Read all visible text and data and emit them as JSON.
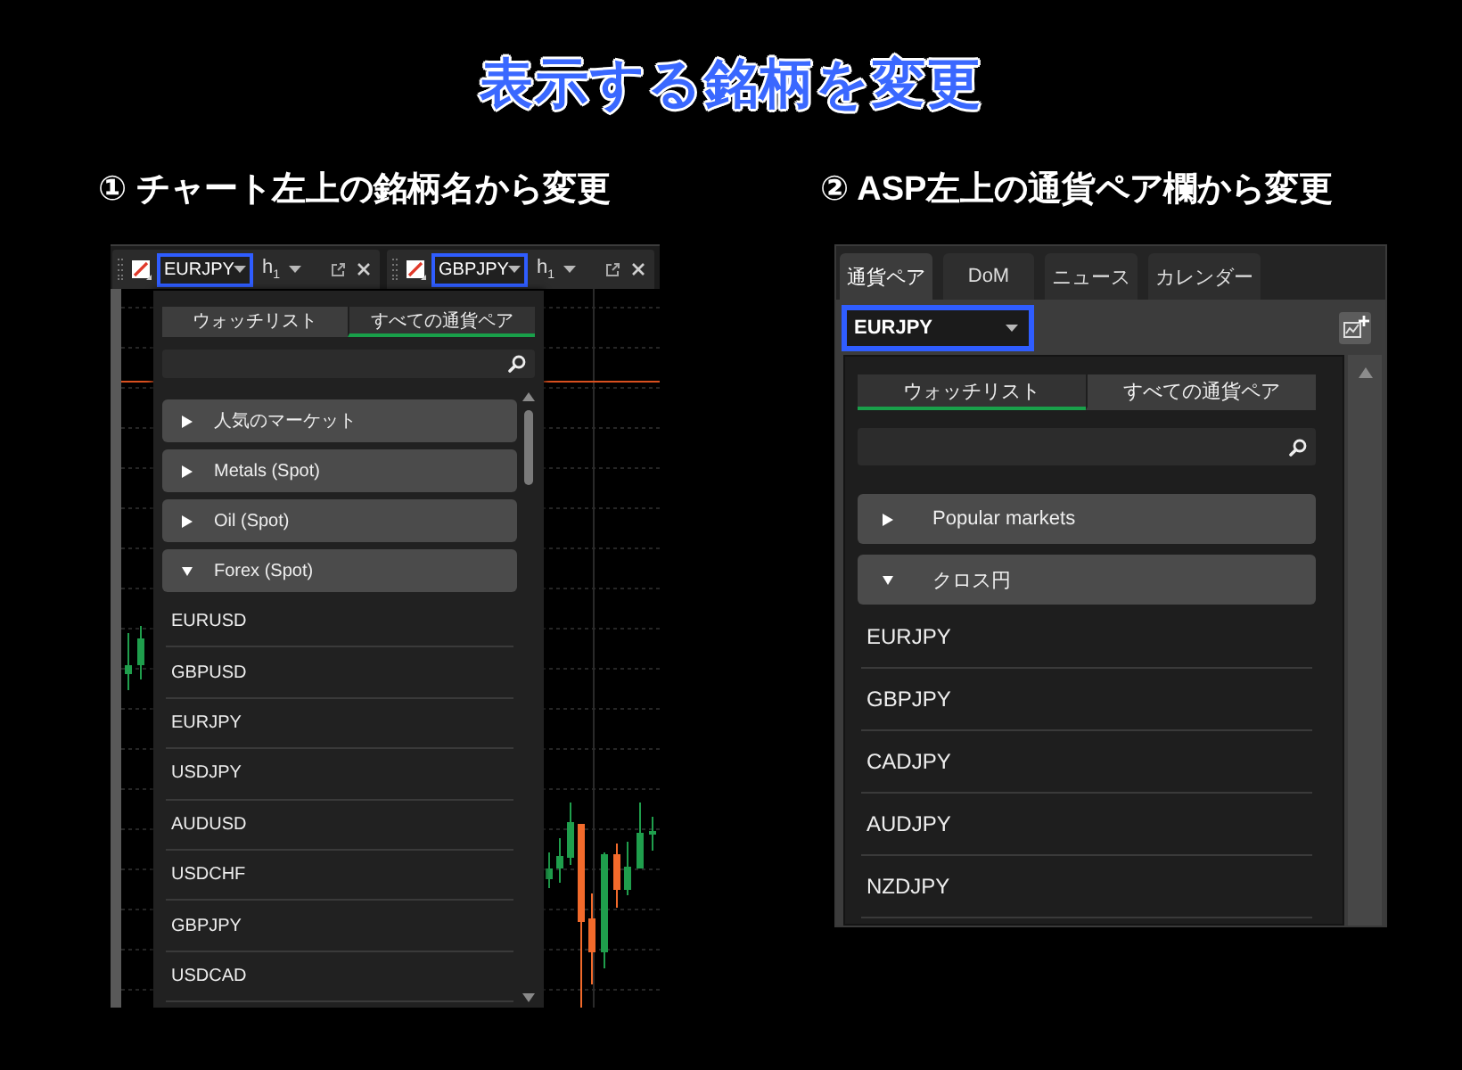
{
  "title": "表示する銘柄を変更",
  "chart_method": {
    "heading": "① チャート左上の銘柄名から変更",
    "chart_tabs": [
      {
        "symbol": "EURJPY",
        "timeframe": "h$_{1}$",
        "highlighted": true
      },
      {
        "symbol": "GBPJPY",
        "timeframe": "h$_{1}$",
        "highlighted": true
      }
    ],
    "picker": {
      "tabs": [
        {
          "label": "ウォッチリスト",
          "selected": false
        },
        {
          "label": "すべての通貨ペア",
          "selected": true
        }
      ],
      "groups": [
        {
          "label": "人気のマーケット",
          "expanded": false
        },
        {
          "label": "Metals (Spot)",
          "expanded": false
        },
        {
          "label": "Oil (Spot)",
          "expanded": false
        },
        {
          "label": "Forex (Spot)",
          "expanded": true,
          "items": [
            "EURUSD",
            "GBPUSD",
            "EURJPY",
            "USDJPY",
            "AUDUSD",
            "USDCHF",
            "GBPJPY",
            "USDCAD"
          ]
        }
      ]
    }
  },
  "asp_method": {
    "heading": "② ASP左上の通貨ペア欄から変更",
    "tabs": [
      {
        "label": "通貨ペア",
        "selected": true
      },
      {
        "label": "DoM",
        "selected": false
      },
      {
        "label": "ニュース",
        "selected": false
      },
      {
        "label": "カレンダー",
        "selected": false
      }
    ],
    "symbol_field": {
      "value": "EURJPY",
      "highlighted": true
    },
    "picker": {
      "tabs": [
        {
          "label": "ウォッチリスト",
          "selected": true
        },
        {
          "label": "すべての通貨ペア",
          "selected": false
        }
      ],
      "groups": [
        {
          "label": "Popular markets",
          "expanded": false
        },
        {
          "label": "クロス円",
          "expanded": true,
          "items": [
            "EURJPY",
            "GBPJPY",
            "CADJPY",
            "AUDJPY",
            "NZDJPY"
          ]
        }
      ]
    }
  }
}
